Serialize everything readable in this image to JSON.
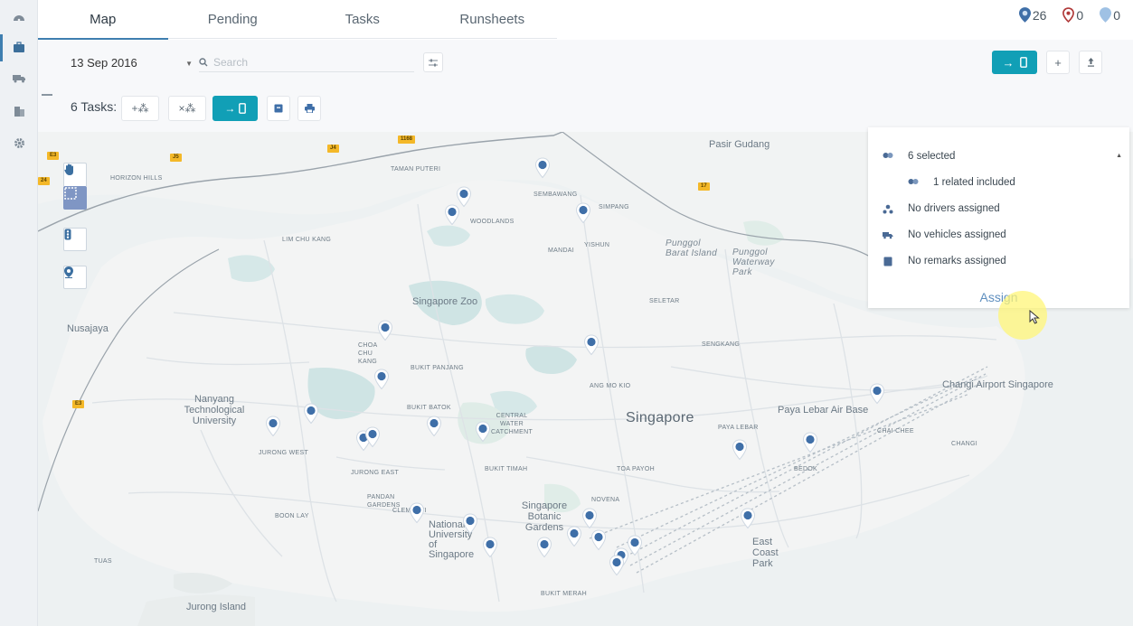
{
  "tabs": [
    {
      "label": "Map",
      "active": true
    },
    {
      "label": "Pending",
      "active": false
    },
    {
      "label": "Tasks",
      "active": false
    },
    {
      "label": "Runsheets",
      "active": false
    }
  ],
  "counts": {
    "blue": "26",
    "red": "0",
    "light": "0",
    "blue_color": "#3f6fa8",
    "red_color": "#b03a3a",
    "light_color": "#9fc1e4"
  },
  "toolbar": {
    "date": "13 Sep 2016",
    "search_placeholder": "Search",
    "tasks_label": "6 Tasks:"
  },
  "side_nav": [
    "dashboard-icon",
    "briefcase-icon",
    "truck-icon",
    "building-icon",
    "gear-icon"
  ],
  "map_labels": {
    "pasir_gudang": "Pasir Gudang",
    "horizon_hills": "HORIZON HILLS",
    "taman_puteri": "TAMAN PUTERI",
    "sembawang": "SEMBAWANG",
    "simpang": "SIMPANG",
    "woodlands": "WOODLANDS",
    "lim_chu_kang": "LIM CHU KANG",
    "mandai": "MANDAI",
    "yishun": "YISHUN",
    "punggol_barat": "Punggol Barat Island",
    "punggol_waterway": "Punggol Waterway Park",
    "seletar": "SELETAR",
    "sengkang": "SENGKANG",
    "singapore_zoo": "Singapore Zoo",
    "nusajaya": "Nusajaya",
    "choa_chu_kang": "CHOA CHU KANG",
    "bukit_panjang": "BUKIT PANJANG",
    "ang_mo_kio": "ANG MO KIO",
    "nanyang": "Nanyang Technological University",
    "bukit_batok": "BUKIT BATOK",
    "central_water": "CENTRAL WATER CATCHMENT",
    "singapore": "Singapore",
    "paya_lebar_air_base": "Paya Lebar Air Base",
    "paya_lebar": "PAYA LEBAR",
    "changi": "Changi Airport Singapore",
    "jurong_west": "JURONG WEST",
    "jurong_east": "JURONG EAST",
    "bukit_timah": "BUKIT TIMAH",
    "toa_payoh": "TOA PAYOH",
    "novena": "NOVENA",
    "bedok": "BEDOK",
    "pandan": "PANDAN GARDENS",
    "clementi": "CLEMENTI",
    "boon_lay": "BOON LAY",
    "botanic": "Singapore Botanic Gardens",
    "nus": "National University of Singapore",
    "tuas": "TUAS",
    "bukit_merah": "BUKIT MERAH",
    "east_coast": "East Coast Park",
    "jurong_island": "Jurong Island",
    "chai_chee": "CHAI CHEE",
    "changi_small": "CHANGI"
  },
  "panel": {
    "selected": "6 selected",
    "related": "1 related included",
    "drivers": "No drivers assigned",
    "vehicles": "No vehicles assigned",
    "remarks": "No remarks assigned",
    "assign": "Assign"
  },
  "colors": {
    "accent": "#119fb6",
    "pin": "#3f6fa8",
    "water": "#cfe4e4",
    "tab_underline": "#3f7fb0"
  }
}
